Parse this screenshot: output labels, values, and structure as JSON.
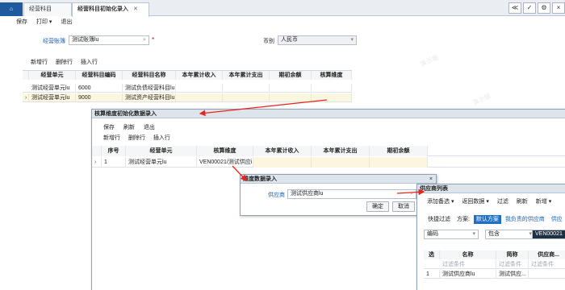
{
  "tabs": [
    {
      "label": "经营科目"
    },
    {
      "label": "经营科目初始化录入",
      "close": "✕"
    }
  ],
  "window_controls": [
    "≪",
    "✓",
    "⚙",
    "×"
  ],
  "toolbar": {
    "save": "保存",
    "print": "打印 ▾",
    "exit": "退出"
  },
  "form": {
    "entity_label": "经营账簿",
    "entity_value": "测试账簿lu",
    "required_mark": "*",
    "currency_label": "币别",
    "currency_value": "人民币"
  },
  "grid_toolbar": {
    "add_row": "新增行",
    "delete_row": "删除行",
    "insert_row": "插入行"
  },
  "grid": {
    "headers": [
      "经营单元",
      "经营科目编码",
      "经营科目名称",
      "本年累计收入",
      "本年累计支出",
      "期初余额",
      "核算维度"
    ],
    "rows": [
      {
        "unit": "测试经营单元lu",
        "code": "6000",
        "name": "测试负债经营科目lu"
      },
      {
        "unit": "测试经营单元lu",
        "code": "9000",
        "name": "测试资产经营科目lu"
      }
    ]
  },
  "init_dialog": {
    "title": "核算维度初始化数据录入",
    "toolbar": {
      "save": "保存",
      "refresh": "刷新",
      "exit": "退出"
    },
    "grid_toolbar": {
      "add_row": "新增行",
      "delete_row": "删除行",
      "insert_row": "插入行"
    },
    "headers": [
      "序号",
      "经营单元",
      "核算维度",
      "本年累计收入",
      "本年累计支出",
      "期初余额"
    ],
    "rows": [
      {
        "seq": "1",
        "unit": "测试经营单元lu",
        "dim": "VEN00021/测试供应i"
      }
    ]
  },
  "dim_dialog": {
    "title": "维度数据录入",
    "close": "×",
    "supplier_label": "供应商",
    "supplier_value": "测试供应商lu",
    "ok": "确定",
    "cancel": "取消"
  },
  "vendor_list": {
    "title": "供应商列表",
    "toolbar": [
      "添加备选 ▾",
      "返回数据 ▾",
      "过滤",
      "刷新",
      "新增 ▾"
    ],
    "quick_filter": "快捷过滤",
    "scheme_label": "方案:",
    "scheme_default": "默认方案",
    "scheme_mine": "我负责的供应商",
    "scheme_more": "供应",
    "filter_field": "编码",
    "filter_op": "包含",
    "filter_value": "VEN00021",
    "headers": [
      "选",
      "名称",
      "简称",
      "供应商..."
    ],
    "filter_row": [
      "过滤条件",
      "过滤条件",
      "过滤条件"
    ],
    "row": {
      "index": "1",
      "name": "测试供应商lu",
      "short": "测试供应..."
    }
  },
  "watermark": "演示版"
}
